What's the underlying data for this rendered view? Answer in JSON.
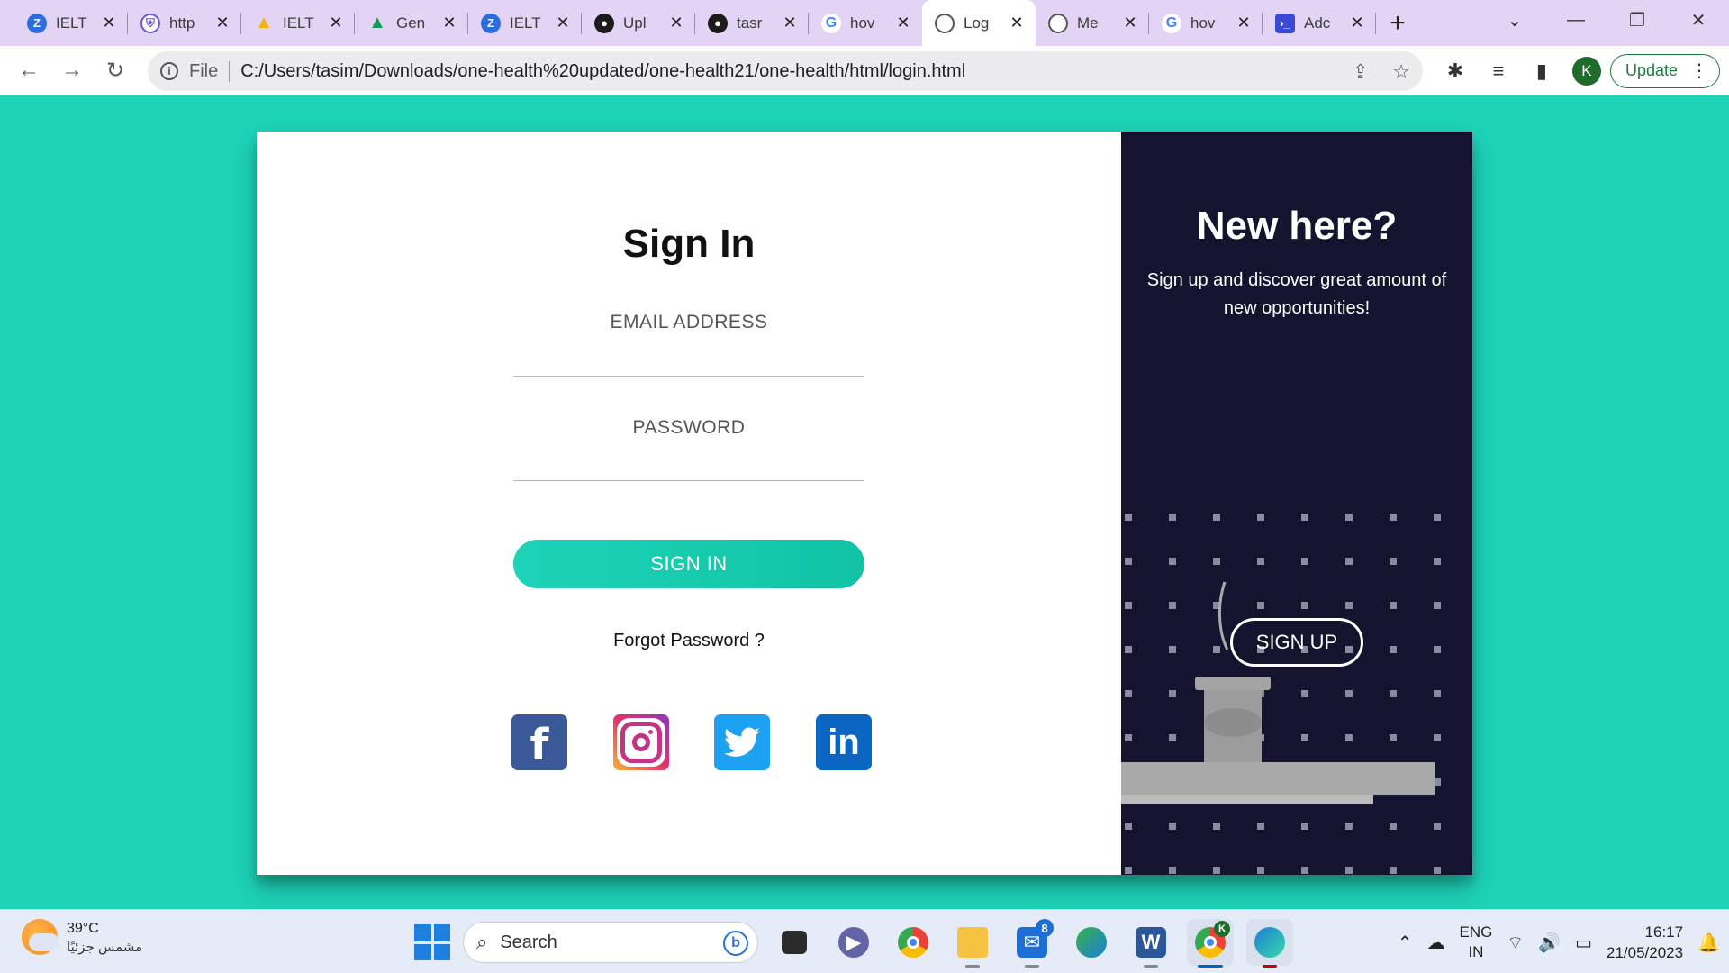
{
  "tabs": [
    {
      "title": "IELT",
      "icon": "z-icon",
      "glyph": "Z"
    },
    {
      "title": "http",
      "icon": "shield-icon",
      "glyph": "⛨"
    },
    {
      "title": "IELT",
      "icon": "drive-icon",
      "glyph": "▲"
    },
    {
      "title": "Gen",
      "icon": "drive-icon",
      "glyph": "▲"
    },
    {
      "title": "IELT",
      "icon": "z-icon",
      "glyph": "Z"
    },
    {
      "title": "Upl",
      "icon": "github-icon",
      "glyph": "●"
    },
    {
      "title": "tasr",
      "icon": "github-icon",
      "glyph": "●"
    },
    {
      "title": "hov",
      "icon": "google-icon",
      "glyph": "G"
    },
    {
      "title": "Log",
      "icon": "globe-icon",
      "glyph": ""
    },
    {
      "title": "Me",
      "icon": "globe-icon",
      "glyph": ""
    },
    {
      "title": "hov",
      "icon": "google-icon",
      "glyph": "G"
    },
    {
      "title": "Adc",
      "icon": "terminal-icon",
      "glyph": "›_"
    }
  ],
  "address_bar": {
    "scheme_label": "File",
    "url": "C:/Users/tasim/Downloads/one-health%20updated/one-health21/one-health/html/login.html"
  },
  "profile_initial": "K",
  "update_label": "Update",
  "signin": {
    "title": "Sign In",
    "email_label": "EMAIL ADDRESS",
    "email_value": "",
    "password_label": "PASSWORD",
    "password_value": "",
    "button_label": "SIGN IN",
    "forgot_label": "Forgot Password ?",
    "socials": [
      "facebook",
      "instagram",
      "twitter",
      "linkedin"
    ]
  },
  "signup_panel": {
    "title": "New here?",
    "subtitle": "Sign up and discover great amount of new opportunities!",
    "button_label": "SIGN UP"
  },
  "taskbar": {
    "temperature": "39°C",
    "weather_desc": "مشمس جزئيًا",
    "search_placeholder": "Search",
    "mail_badge": "8",
    "chrome_badge": "K",
    "lang_line1": "ENG",
    "lang_line2": "IN",
    "time": "16:17",
    "date": "21/05/2023"
  },
  "colors": {
    "page_bg": "#1dd3b8",
    "panel_dark": "#14142f",
    "tab_strip": "#e3d3f5"
  }
}
